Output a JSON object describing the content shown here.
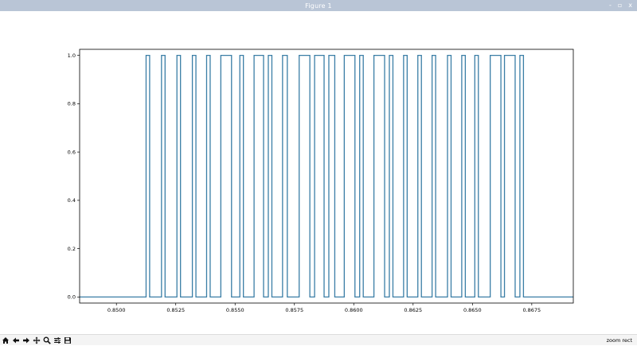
{
  "window": {
    "title": "Figure 1",
    "controls": [
      "-",
      "▫",
      "x"
    ]
  },
  "toolbar": {
    "tools": [
      "home-icon",
      "back-icon",
      "forward-icon",
      "pan-icon",
      "zoom-icon",
      "configure-subplots-icon",
      "save-icon"
    ],
    "status": "zoom rect"
  },
  "chart_data": {
    "type": "line",
    "step": true,
    "line_color": "#3a7ea6",
    "xlim": [
      0.84845,
      0.86925
    ],
    "ylim": [
      -0.025,
      1.025
    ],
    "xticks": [
      0.85,
      0.8525,
      0.855,
      0.8575,
      0.86,
      0.8625,
      0.865,
      0.8675
    ],
    "xtick_labels": [
      "0.8500",
      "0.8525",
      "0.8550",
      "0.8575",
      "0.8600",
      "0.8625",
      "0.8650",
      "0.8675"
    ],
    "yticks": [
      0.0,
      0.2,
      0.4,
      0.6,
      0.8,
      1.0
    ],
    "ytick_labels": [
      "0.0",
      "0.2",
      "0.4",
      "0.6",
      "0.8",
      "1.0"
    ],
    "high_intervals": [
      [
        0.85125,
        0.8514
      ],
      [
        0.8519,
        0.85205
      ],
      [
        0.85255,
        0.8527
      ],
      [
        0.8532,
        0.85335
      ],
      [
        0.8538,
        0.85395
      ],
      [
        0.8544,
        0.85485
      ],
      [
        0.8552,
        0.85535
      ],
      [
        0.8558,
        0.8562
      ],
      [
        0.8564,
        0.85655
      ],
      [
        0.857,
        0.8572
      ],
      [
        0.8577,
        0.85815
      ],
      [
        0.85835,
        0.85875
      ],
      [
        0.85895,
        0.8592
      ],
      [
        0.8596,
        0.86005
      ],
      [
        0.86025,
        0.8604
      ],
      [
        0.86085,
        0.8613
      ],
      [
        0.8615,
        0.86165
      ],
      [
        0.8621,
        0.86225
      ],
      [
        0.8627,
        0.86285
      ],
      [
        0.8633,
        0.86345
      ],
      [
        0.86395,
        0.8641
      ],
      [
        0.86455,
        0.8647
      ],
      [
        0.8651,
        0.86525
      ],
      [
        0.86575,
        0.8662
      ],
      [
        0.86635,
        0.8668
      ],
      [
        0.867,
        0.86715
      ]
    ]
  }
}
